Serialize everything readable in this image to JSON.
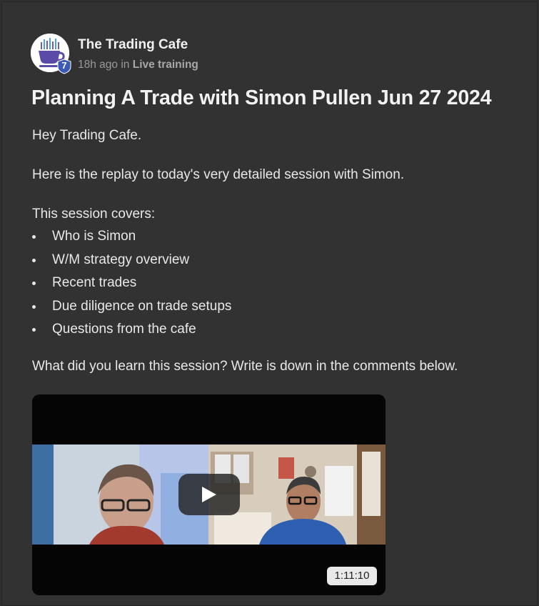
{
  "post": {
    "author": "The Trading Cafe",
    "author_level": "7",
    "time_ago": "18h ago",
    "in_word": "in",
    "category": "Live training",
    "title": "Planning A Trade with Simon Pullen Jun 27 2024",
    "greeting": "Hey Trading Cafe.",
    "intro": "Here is the replay to today's very detailed session with Simon.",
    "covers_heading": "This session covers:",
    "topics": [
      "Who is Simon",
      "W/M strategy overview",
      "Recent trades",
      "Due diligence on trade setups",
      "Questions from the cafe"
    ],
    "closing": "What did you learn this session? Write is down in the comments below."
  },
  "video": {
    "duration": "1:11:10",
    "play_icon": "play-icon"
  },
  "colors": {
    "background": "#323232",
    "text": "#e8e8e8",
    "badge": "#3b5bb5",
    "logo_purple": "#5b4aa8"
  }
}
